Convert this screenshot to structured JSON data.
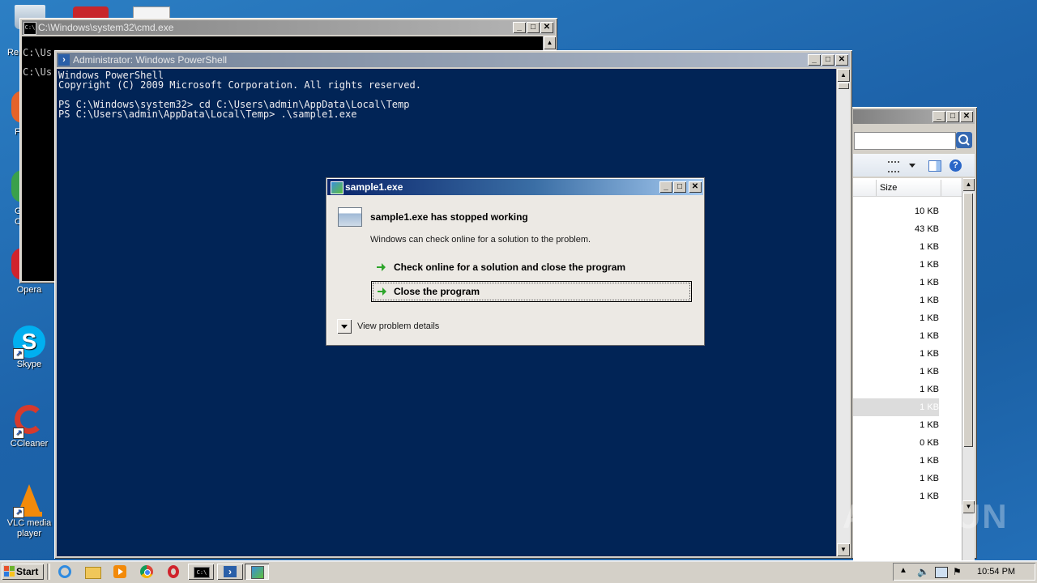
{
  "desktop": {
    "icons": [
      {
        "label": "Opera"
      },
      {
        "label": "Skype"
      },
      {
        "label": "CCleaner"
      },
      {
        "label": "VLC media player"
      }
    ],
    "partial_labels": [
      "Re",
      "F",
      "G",
      "C"
    ]
  },
  "cmd_window": {
    "title": "C:\\Windows\\system32\\cmd.exe",
    "lines": [
      "C:\\Us",
      "C:\\Us"
    ]
  },
  "powershell_window": {
    "title": "Administrator: Windows PowerShell",
    "lines": [
      "Windows PowerShell",
      "Copyright (C) 2009 Microsoft Corporation. All rights reserved.",
      "",
      "PS C:\\Windows\\system32> cd C:\\Users\\admin\\AppData\\Local\\Temp",
      "PS C:\\Users\\admin\\AppData\\Local\\Temp> .\\sample1.exe"
    ]
  },
  "explorer_window": {
    "column_header": "Size",
    "sizes": [
      "10 KB",
      "43 KB",
      "1 KB",
      "1 KB",
      "1 KB",
      "1 KB",
      "1 KB",
      "1 KB",
      "1 KB",
      "1 KB",
      "1 KB",
      "1 KB",
      "1 KB",
      "0 KB",
      "1 KB",
      "1 KB",
      "1 KB"
    ],
    "selected_index": 11
  },
  "dialog": {
    "title": "sample1.exe",
    "heading": "sample1.exe has stopped working",
    "message": "Windows can check online for a solution to the problem.",
    "option_check_online": "Check online for a solution and close the program",
    "option_close": "Close the program",
    "details_label": "View problem details"
  },
  "taskbar": {
    "start_label": "Start",
    "clock": "10:54 PM"
  },
  "watermark": "ANY RUN",
  "colors": {
    "powershell_bg": "#012456",
    "desktop_bg": "#1d63aa"
  }
}
